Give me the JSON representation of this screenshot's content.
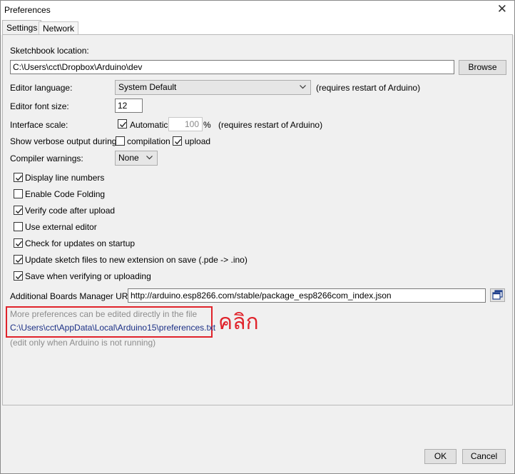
{
  "window": {
    "title": "Preferences",
    "close_glyph": "✕"
  },
  "tabs": [
    {
      "label": "Settings",
      "active": true
    },
    {
      "label": "Network",
      "active": false
    }
  ],
  "settings": {
    "sketchbook": {
      "label": "Sketchbook location:",
      "value": "C:\\Users\\cct\\Dropbox\\Arduino\\dev",
      "browse_label": "Browse"
    },
    "editor_language": {
      "label": "Editor language:",
      "value": "System Default",
      "note": "(requires restart of Arduino)"
    },
    "editor_font_size": {
      "label": "Editor font size:",
      "value": "12"
    },
    "interface_scale": {
      "label": "Interface scale:",
      "automatic_label": "Automatic",
      "automatic_checked": true,
      "value": "100",
      "unit": "%",
      "note": "(requires restart of Arduino)"
    },
    "verbose": {
      "label": "Show verbose output during:",
      "compilation_label": "compilation",
      "compilation_checked": false,
      "upload_label": "upload",
      "upload_checked": true
    },
    "compiler_warnings": {
      "label": "Compiler warnings:",
      "value": "None"
    },
    "options": [
      {
        "label": "Display line numbers",
        "checked": true
      },
      {
        "label": "Enable Code Folding",
        "checked": false
      },
      {
        "label": "Verify code after upload",
        "checked": true
      },
      {
        "label": "Use external editor",
        "checked": false
      },
      {
        "label": "Check for updates on startup",
        "checked": true
      },
      {
        "label": "Update sketch files to new extension on save (.pde -> .ino)",
        "checked": true
      },
      {
        "label": "Save when verifying or uploading",
        "checked": true
      }
    ],
    "boards_manager": {
      "label": "Additional Boards Manager URLs:",
      "value": "http://arduino.esp8266.com/stable/package_esp8266com_index.json"
    },
    "more_prefs": {
      "hint": "More preferences can be edited directly in the file",
      "path": "C:\\Users\\cct\\AppData\\Local\\Arduino15\\preferences.txt",
      "footnote": "(edit only when Arduino is not running)"
    },
    "annotation": "คลิก"
  },
  "footer": {
    "ok_label": "OK",
    "cancel_label": "Cancel"
  },
  "colors": {
    "annotation": "#e0232b",
    "link": "#1b2f85",
    "hint": "#8d8d8d"
  }
}
